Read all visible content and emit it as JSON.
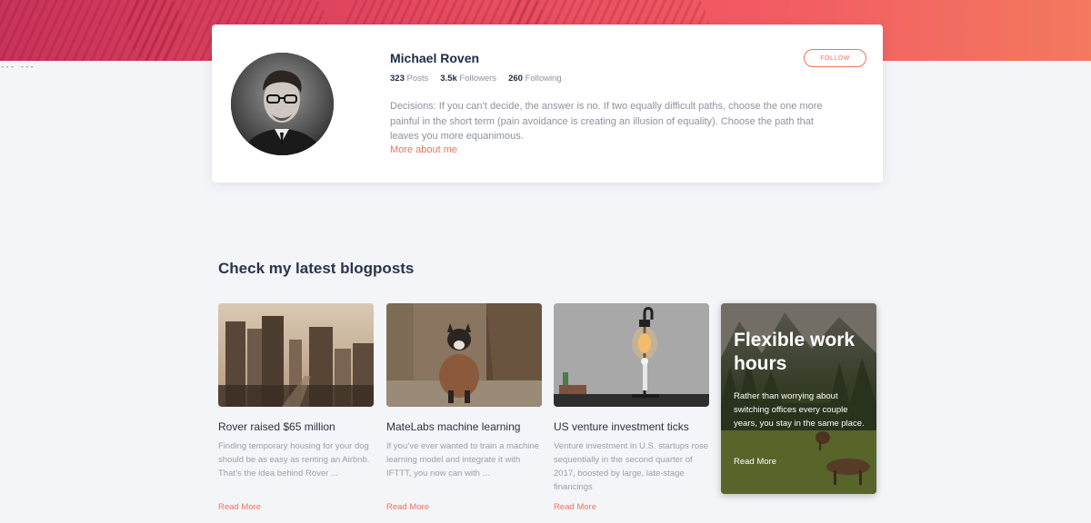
{
  "profile": {
    "name": "Michael Roven",
    "stats": [
      {
        "count": "323",
        "label": "Posts"
      },
      {
        "count": "3.5k",
        "label": "Followers"
      },
      {
        "count": "260",
        "label": "Following"
      }
    ],
    "follow_label": "FOLLOW",
    "bio": "Decisions: If you can’t decide, the answer is no. If two equally difficult paths, choose the one more painful in the short term (pain avoidance is creating an illusion of equality). Choose the path that leaves you more equanimous.",
    "more_link": "More about me"
  },
  "marker_text": "--- ---",
  "blog": {
    "heading": "Check my latest blogposts",
    "posts": [
      {
        "title": "Rover raised $65 million",
        "excerpt": "Finding temporary housing for your dog should be as easy as renting an Airbnb. That’s the idea behind Rover ...",
        "read_more": "Read More",
        "image": "city-skyline"
      },
      {
        "title": "MateLabs machine learning",
        "excerpt": "If you’ve ever wanted to train a machine learning model and integrate it with IFTTT, you now can with ...",
        "read_more": "Read More",
        "image": "dog-in-coat"
      },
      {
        "title": "US venture investment ticks",
        "excerpt": "Venture investment in U.S. startups rose sequentially in the second quarter of 2017, boosted by large, late-stage financings",
        "read_more": "Read More",
        "image": "lamp-figurine"
      }
    ],
    "feature": {
      "title": "Flexible work hours",
      "text": "Rather than worrying about switching offices every couple years, you stay in the same place.",
      "read_more": "Read More",
      "image": "deer-meadow"
    }
  },
  "colors": {
    "accent": "#f0735f",
    "hero_start": "#c8335a",
    "hero_end": "#f3795f",
    "heading": "#2b3350",
    "page_bg": "#f4f5f8"
  }
}
